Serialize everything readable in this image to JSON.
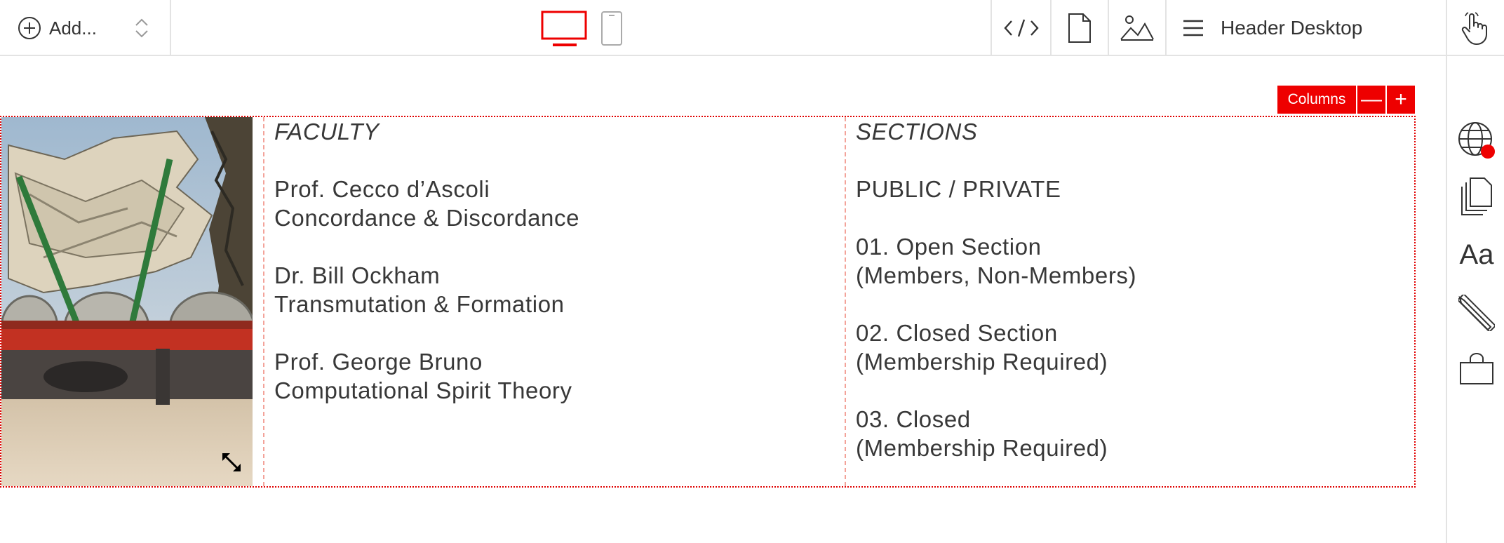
{
  "toolbar": {
    "add_label": "Add...",
    "page_name": "Header Desktop",
    "icons": [
      "plus-circle-icon",
      "sort-updown-icon",
      "desktop-icon",
      "mobile-icon",
      "code-icon",
      "page-icon",
      "image-icon",
      "menu-icon",
      "hand-icon"
    ]
  },
  "columns_control": {
    "label": "Columns",
    "minus": "—",
    "plus": "+"
  },
  "faculty": {
    "heading": "FACULTY",
    "members": [
      {
        "name": "Prof. Cecco d’Ascoli",
        "subject": "Concordance & Discordance"
      },
      {
        "name": "Dr. Bill Ockham",
        "subject": "Transmutation & Formation"
      },
      {
        "name": "Prof. George Bruno",
        "subject": "Computational Spirit Theory"
      }
    ]
  },
  "sections": {
    "heading": "SECTIONS",
    "intro": "PUBLIC / PRIVATE",
    "items": [
      {
        "title": "01. Open Section",
        "note": "(Members, Non-Members)"
      },
      {
        "title": "02. Closed Section",
        "note": "(Membership Required)"
      },
      {
        "title": "03. Closed",
        "note": "(Membership Required)"
      }
    ]
  },
  "sidebar": {
    "aa_label": "Aa"
  },
  "colors": {
    "accent": "#ee0000",
    "text": "#383838",
    "border": "#e3e3e3"
  }
}
